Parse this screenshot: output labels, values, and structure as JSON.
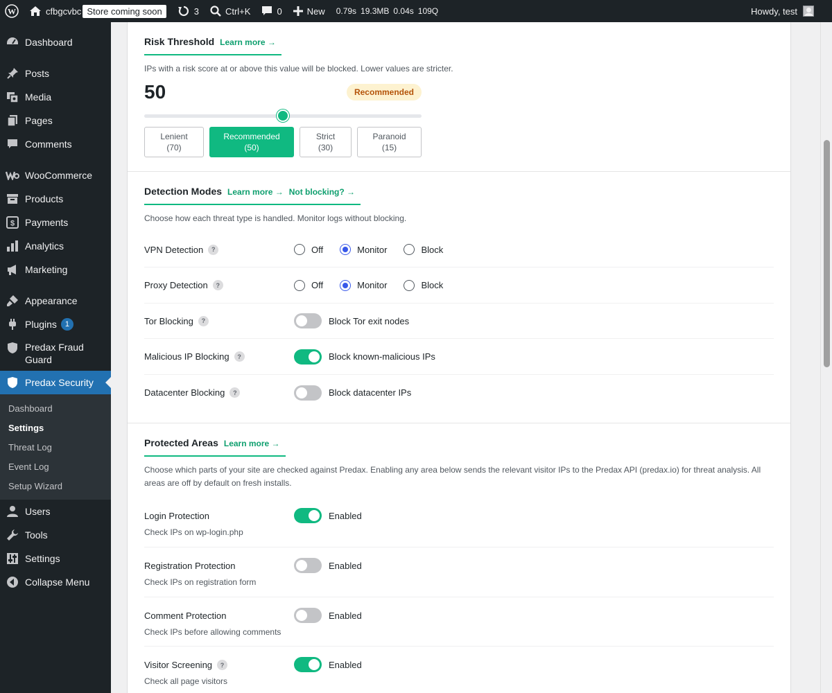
{
  "adminbar": {
    "site_name": "cfbgcvbc",
    "store_badge": "Store coming soon",
    "updates_count": "3",
    "search_shortcut": "Ctrl+K",
    "comments_count": "0",
    "new_label": "New",
    "query_time": "0.79s",
    "memory": "19.3MB",
    "db_time": "0.04s",
    "queries": "109Q",
    "howdy": "Howdy, test"
  },
  "sidebar": {
    "items": [
      {
        "label": "Dashboard",
        "icon": "dashboard-icon"
      },
      {
        "label": "Posts",
        "icon": "pin-icon"
      },
      {
        "label": "Media",
        "icon": "media-icon"
      },
      {
        "label": "Pages",
        "icon": "pages-icon"
      },
      {
        "label": "Comments",
        "icon": "comment-icon"
      },
      {
        "label": "WooCommerce",
        "icon": "woo-icon"
      },
      {
        "label": "Products",
        "icon": "archive-icon"
      },
      {
        "label": "Payments",
        "icon": "dollar-icon"
      },
      {
        "label": "Analytics",
        "icon": "bar-chart-icon"
      },
      {
        "label": "Marketing",
        "icon": "megaphone-icon"
      },
      {
        "label": "Appearance",
        "icon": "brush-icon"
      },
      {
        "label": "Plugins",
        "icon": "plug-icon",
        "badge": "1"
      },
      {
        "label": "Predax Fraud Guard",
        "icon": "shield-icon"
      },
      {
        "label": "Predax Security",
        "icon": "shield-icon"
      },
      {
        "label": "Users",
        "icon": "user-icon"
      },
      {
        "label": "Tools",
        "icon": "wrench-icon"
      },
      {
        "label": "Settings",
        "icon": "sliders-icon"
      },
      {
        "label": "Collapse Menu",
        "icon": "collapse-icon"
      }
    ],
    "submenu": [
      "Dashboard",
      "Settings",
      "Threat Log",
      "Event Log",
      "Setup Wizard"
    ]
  },
  "threshold": {
    "title": "Risk Threshold",
    "learn_more": "Learn more →",
    "description": "IPs with a risk score at or above this value will be blocked. Lower values are stricter.",
    "value": "50",
    "badge": "Recommended",
    "slider_fraction": 0.5,
    "presets": [
      {
        "name": "Lenient",
        "value": "(70)"
      },
      {
        "name": "Recommended",
        "value": "(50)"
      },
      {
        "name": "Strict",
        "value": "(30)"
      },
      {
        "name": "Paranoid",
        "value": "(15)"
      }
    ]
  },
  "detection": {
    "title": "Detection Modes",
    "learn_more": "Learn more →",
    "not_blocking": "Not blocking? →",
    "description": "Choose how each threat type is handled. Monitor logs without blocking.",
    "radio_options": [
      "Off",
      "Monitor",
      "Block"
    ],
    "rows": [
      {
        "label": "VPN Detection",
        "selected": "Monitor"
      },
      {
        "label": "Proxy Detection",
        "selected": "Monitor"
      },
      {
        "label": "Tor Blocking",
        "toggle_label": "Block Tor exit nodes",
        "on": false
      },
      {
        "label": "Malicious IP Blocking",
        "toggle_label": "Block known-malicious IPs",
        "on": true
      },
      {
        "label": "Datacenter Blocking",
        "toggle_label": "Block datacenter IPs",
        "on": false
      }
    ]
  },
  "protected": {
    "title": "Protected Areas",
    "learn_more": "Learn more →",
    "description": "Choose which parts of your site are checked against Predax. Enabling any area below sends the relevant visitor IPs to the Predax API (predax.io) for threat analysis. All areas are off by default on fresh installs.",
    "toggle_label": "Enabled",
    "rows": [
      {
        "label": "Login Protection",
        "sub": "Check IPs on wp-login.php",
        "on": true
      },
      {
        "label": "Registration Protection",
        "sub": "Check IPs on registration form",
        "on": false
      },
      {
        "label": "Comment Protection",
        "sub": "Check IPs before allowing comments",
        "on": false
      },
      {
        "label": "Visitor Screening",
        "sub": "Check all page visitors",
        "on": true
      }
    ]
  },
  "colors": {
    "accent": "#10b981",
    "radio": "#3858e9",
    "badge_bg": "#fdf2d0",
    "badge_text": "#b45309"
  }
}
